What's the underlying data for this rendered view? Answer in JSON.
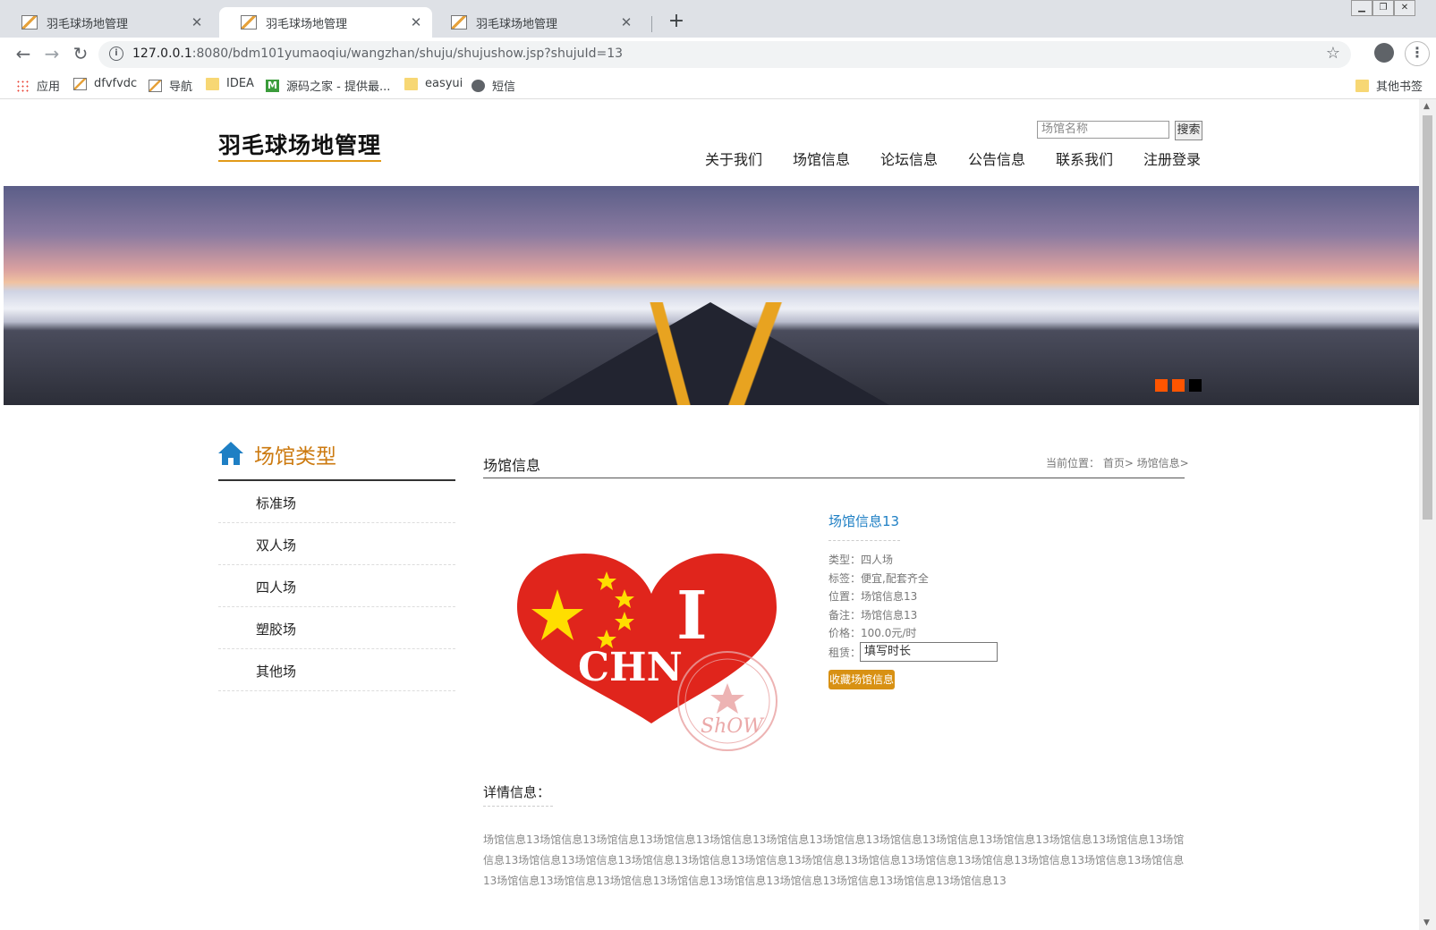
{
  "browser": {
    "tabs": [
      {
        "title": "羽毛球场地管理",
        "active": false
      },
      {
        "title": "羽毛球场地管理",
        "active": true
      },
      {
        "title": "羽毛球场地管理",
        "active": false
      }
    ],
    "url_host": "127.0.0.1",
    "url_rest": ":8080/bdm101yumaoqiu/wangzhan/shuju/shujushow.jsp?shujuId=13",
    "bookmarks": [
      {
        "label": "应用",
        "icon": "apps-grid-icon"
      },
      {
        "label": "dfvfvdc",
        "icon": "page-icon"
      },
      {
        "label": "导航",
        "icon": "page-icon"
      },
      {
        "label": "IDEA",
        "icon": "folder-icon"
      },
      {
        "label": "源码之家 - 提供最...",
        "icon": "m-logo-icon"
      },
      {
        "label": "easyui",
        "icon": "folder-icon"
      },
      {
        "label": "短信",
        "icon": "globe-icon"
      }
    ],
    "other_bookmarks": "其他书签"
  },
  "site": {
    "logo": "羽毛球场地管理",
    "search_placeholder": "场馆名称",
    "search_button": "搜索",
    "nav": [
      "关于我们",
      "场馆信息",
      "论坛信息",
      "公告信息",
      "联系我们",
      "注册登录"
    ],
    "banner_dots": [
      "#ff5500",
      "#ff5500",
      "#000000"
    ]
  },
  "sidebar": {
    "title": "场馆类型",
    "items": [
      "标准场",
      "双人场",
      "四人场",
      "塑胶场",
      "其他场"
    ]
  },
  "main": {
    "title": "场馆信息",
    "breadcrumb": "当前位置： 首页> 场馆信息>",
    "image": {
      "mark": "I",
      "text": "CHN",
      "stamp": "ShOW"
    },
    "detail": {
      "name": "场馆信息13",
      "type": "类型：四人场",
      "tags": "标签：便宜,配套齐全",
      "location": "位置：场馆信息13",
      "note": "备注：场馆信息13",
      "price": "价格：100.0元/时",
      "rent_label": "租赁：",
      "rent_value": "填写时长",
      "favorite_button": "收藏场馆信息"
    },
    "details_label": "详情信息：",
    "details_text": "场馆信息13场馆信息13场馆信息13场馆信息13场馆信息13场馆信息13场馆信息13场馆信息13场馆信息13场馆信息13场馆信息13场馆信息13场馆信息13场馆信息13场馆信息13场馆信息13场馆信息13场馆信息13场馆信息13场馆信息13场馆信息13场馆信息13场馆信息13场馆信息13场馆信息13场馆信息13场馆信息13场馆信息13场馆信息13场馆信息13场馆信息13场馆信息13场馆信息13场馆信息13"
  }
}
